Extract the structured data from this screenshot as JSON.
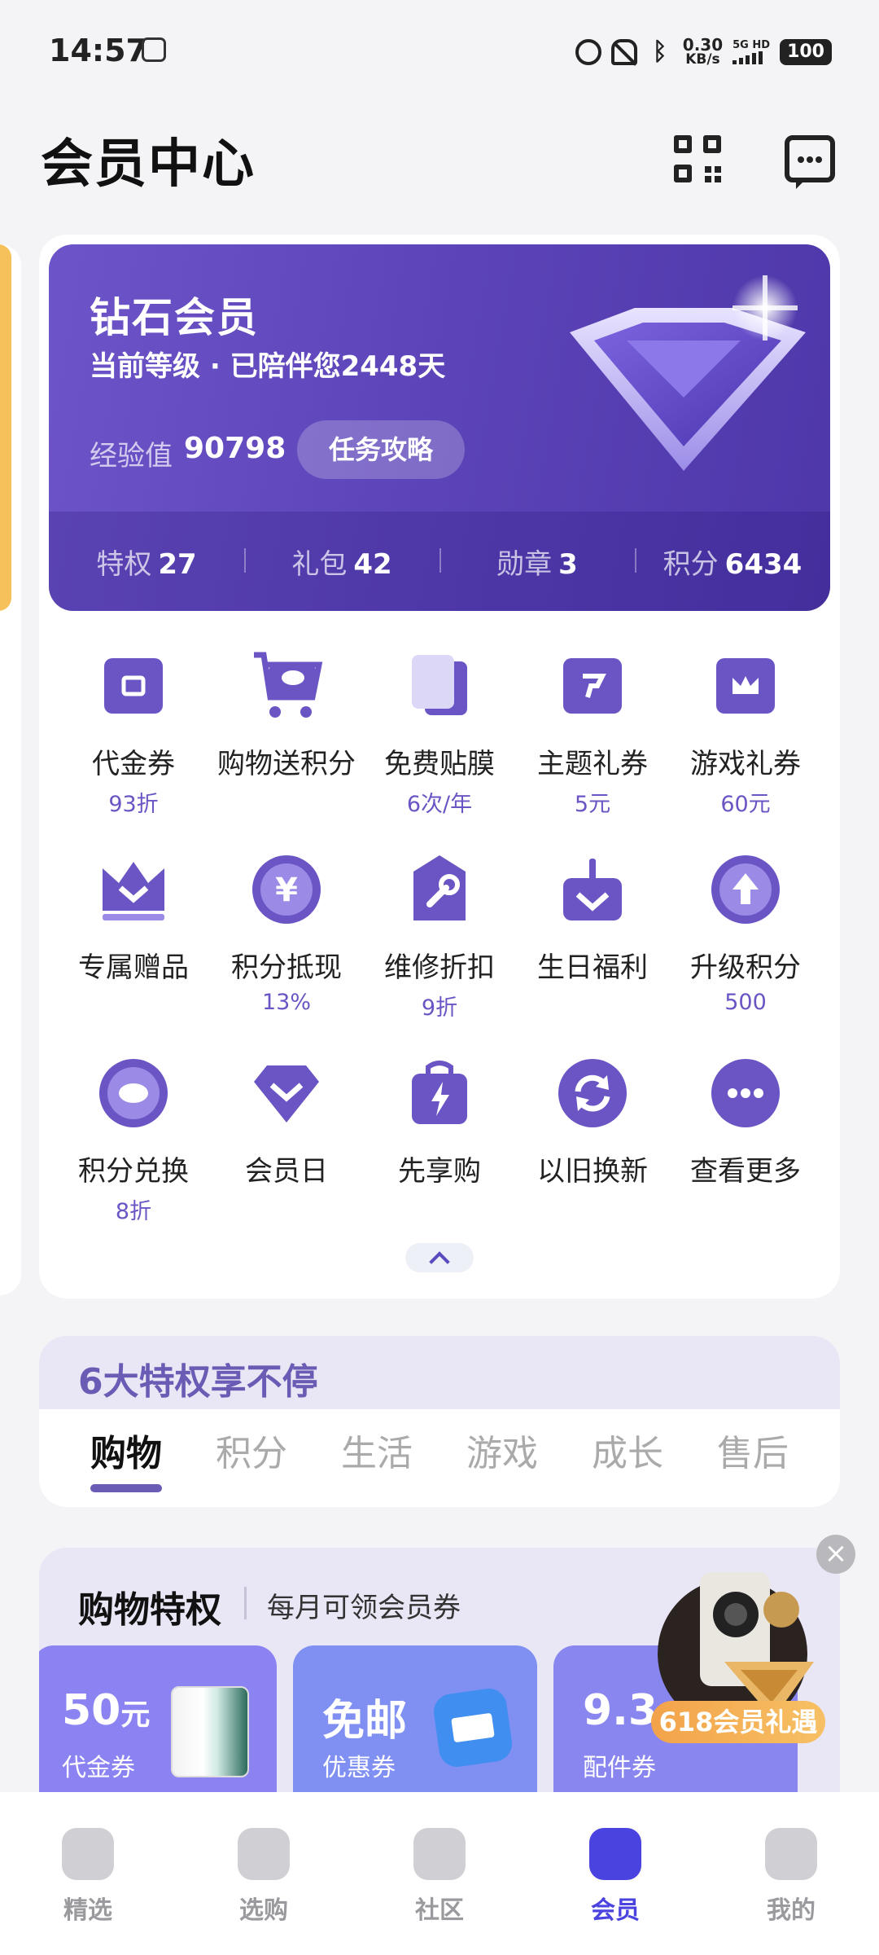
{
  "status_bar": {
    "time": "14:57",
    "net_speed_value": "0.30",
    "net_speed_unit": "KB/s",
    "signal_label": "5G HD",
    "battery": "100"
  },
  "header": {
    "title": "会员中心",
    "qr_icon": "qr-code-icon",
    "message_icon": "message-icon"
  },
  "member": {
    "level": "钻石会员",
    "days_text": "当前等级 · 已陪伴您2448天",
    "exp_label": "经验值",
    "exp_value": "90798",
    "task_button": "任务攻略",
    "stats": [
      {
        "label": "特权",
        "value": "27"
      },
      {
        "label": "礼包",
        "value": "42"
      },
      {
        "label": "勋章",
        "value": "3"
      },
      {
        "label": "积分",
        "value": "6434"
      }
    ]
  },
  "benefits": [
    {
      "label": "代金券",
      "sub": "93折",
      "icon": "ticket-icon"
    },
    {
      "label": "购物送积分",
      "sub": "",
      "icon": "cart-icon"
    },
    {
      "label": "免费贴膜",
      "sub": "6次/年",
      "icon": "screen-film-icon"
    },
    {
      "label": "主题礼券",
      "sub": "5元",
      "icon": "theme-ticket-icon"
    },
    {
      "label": "游戏礼券",
      "sub": "60元",
      "icon": "crown-ticket-icon"
    },
    {
      "label": "专属赠品",
      "sub": "",
      "icon": "crown-icon"
    },
    {
      "label": "积分抵现",
      "sub": "13%",
      "icon": "yen-coin-icon"
    },
    {
      "label": "维修折扣",
      "sub": "9折",
      "icon": "wrench-tag-icon"
    },
    {
      "label": "生日福利",
      "sub": "",
      "icon": "gift-box-icon"
    },
    {
      "label": "升级积分",
      "sub": "500",
      "icon": "arrow-up-coin-icon"
    },
    {
      "label": "积分兑换",
      "sub": "8折",
      "icon": "points-coin-icon"
    },
    {
      "label": "会员日",
      "sub": "",
      "icon": "diamond-icon"
    },
    {
      "label": "先享购",
      "sub": "",
      "icon": "lightning-bag-icon"
    },
    {
      "label": "以旧换新",
      "sub": "",
      "icon": "exchange-icon"
    },
    {
      "label": "查看更多",
      "sub": "",
      "icon": "more-icon"
    }
  ],
  "privileges": {
    "title": "6大特权享不停",
    "tabs": [
      "购物",
      "积分",
      "生活",
      "游戏",
      "成长",
      "售后"
    ],
    "active_tab": 0
  },
  "shopping": {
    "title": "购物特权",
    "subtitle": "每月可领会员券",
    "coupons": [
      {
        "amount": "50",
        "unit": "元",
        "name": "代金券",
        "color": "#8b83f2"
      },
      {
        "amount": "免邮",
        "unit": "",
        "name": "优惠券",
        "color": "#7f8ff2"
      },
      {
        "amount": "9.3",
        "unit": "",
        "name": "配件券",
        "color": "#8a86ef"
      }
    ]
  },
  "promo": {
    "label": "618会员礼遇",
    "close": "×"
  },
  "bottom_nav": [
    {
      "label": "精选",
      "icon": "heart-icon"
    },
    {
      "label": "选购",
      "icon": "shopping-bag-icon"
    },
    {
      "label": "社区",
      "icon": "chat-bubble-icon"
    },
    {
      "label": "会员",
      "icon": "diamond-icon"
    },
    {
      "label": "我的",
      "icon": "profile-icon"
    }
  ],
  "active_nav": 3,
  "colors": {
    "accent": "#4a43e0",
    "banner": "#5c44b8",
    "benefit_icon": "#6b55c4"
  }
}
